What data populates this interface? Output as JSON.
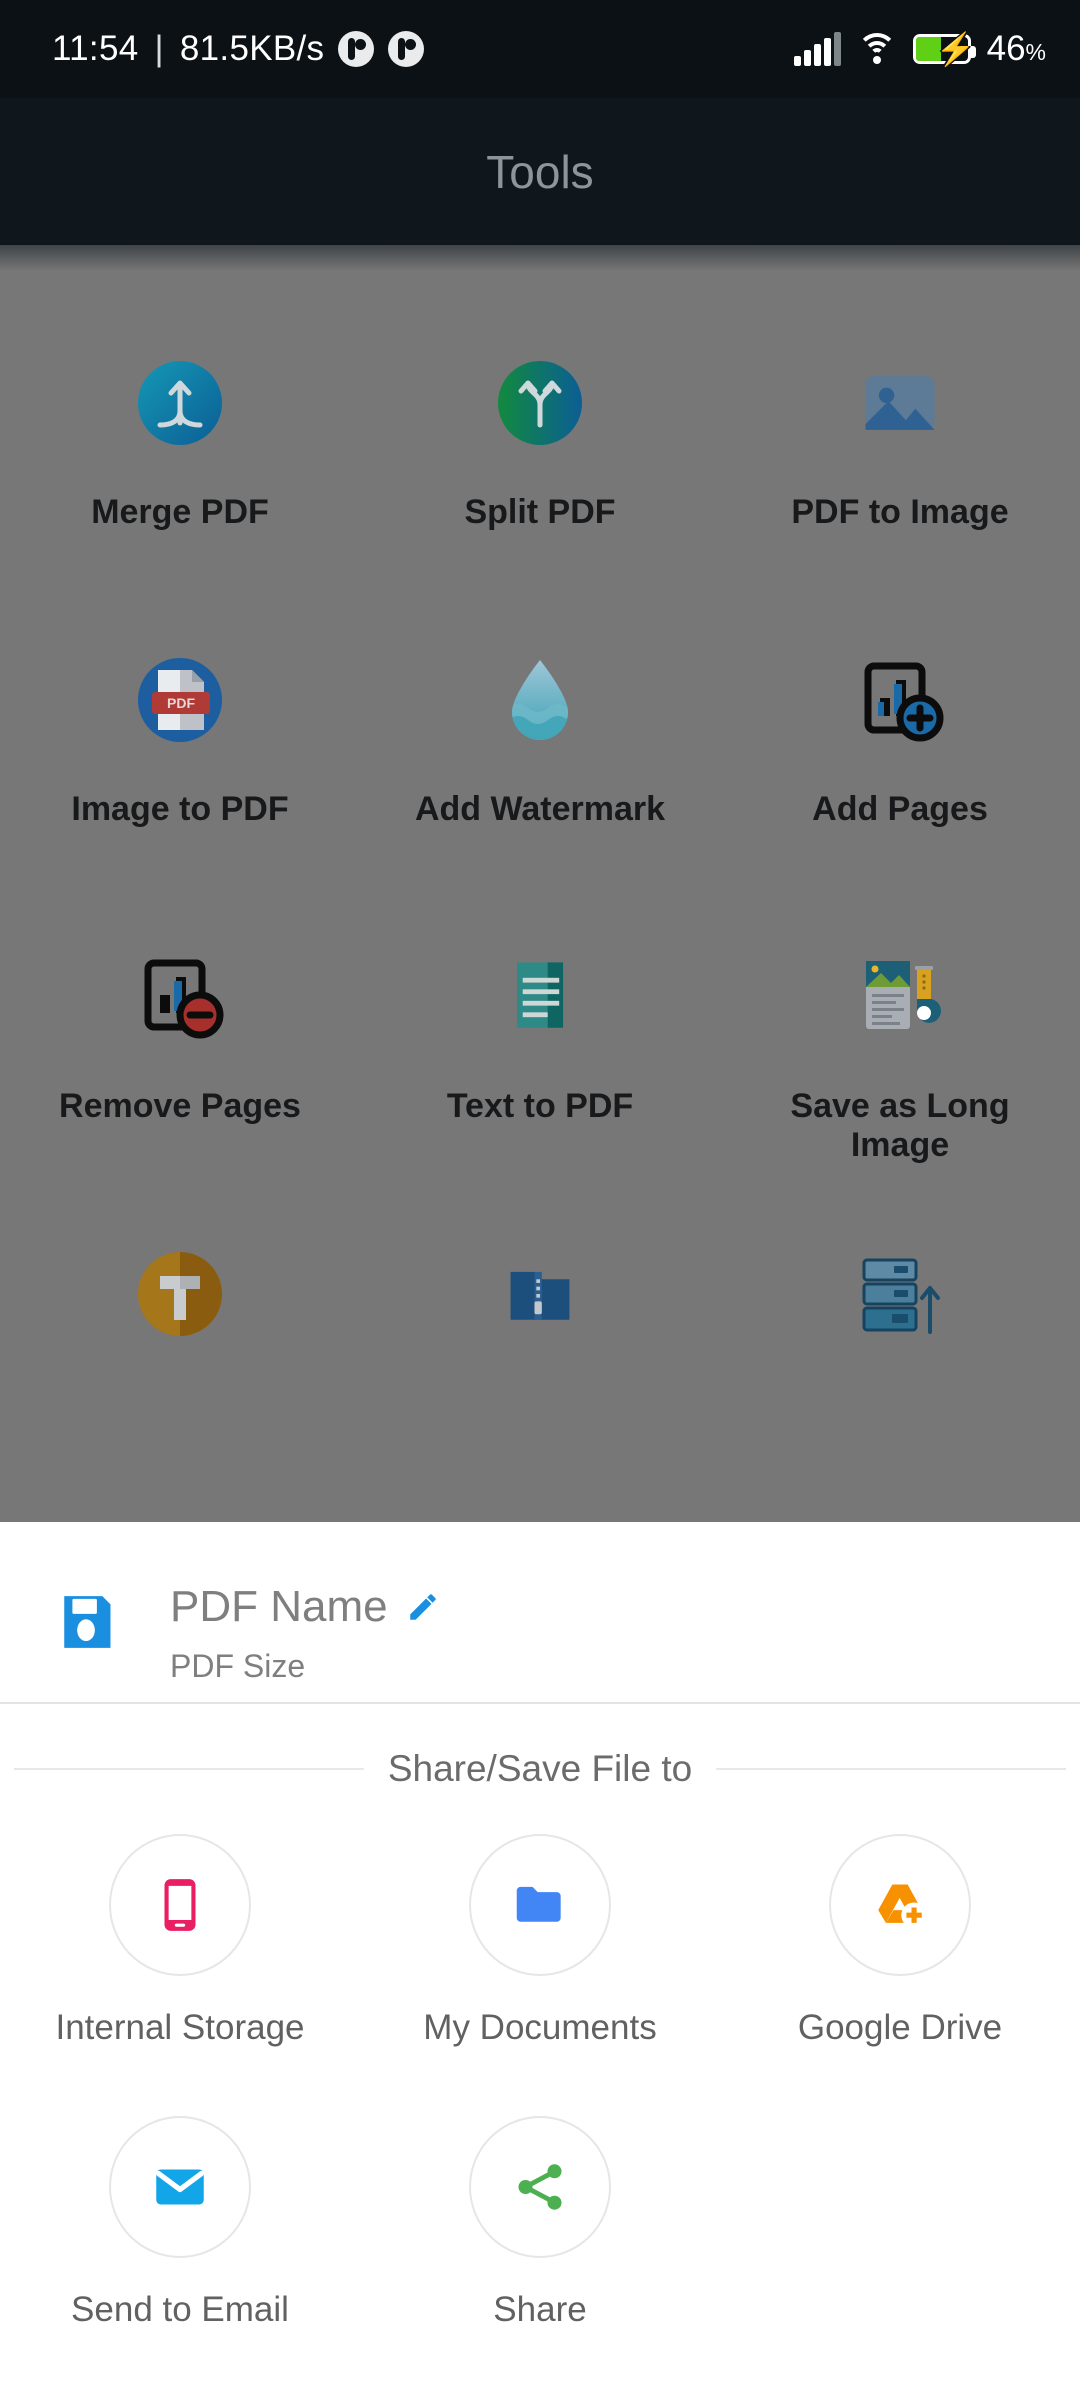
{
  "status_bar": {
    "time": "11:54",
    "separator": "|",
    "network_speed": "81.5KB/s",
    "notification_icons": [
      "app-notification-icon",
      "app-notification-icon"
    ],
    "signal_icon": "signal-bars-icon",
    "wifi_icon": "wifi-icon",
    "battery_icon": "battery-charging-icon",
    "battery_percent": "46",
    "battery_percent_symbol": "%"
  },
  "app_bar": {
    "title": "Tools"
  },
  "tools": {
    "items": [
      {
        "label": "Merge PDF",
        "icon": "merge-pdf-icon"
      },
      {
        "label": "Split PDF",
        "icon": "split-pdf-icon"
      },
      {
        "label": "PDF to Image",
        "icon": "pdf-to-image-icon"
      },
      {
        "label": "Image to PDF",
        "icon": "image-to-pdf-icon"
      },
      {
        "label": "Add Watermark",
        "icon": "add-watermark-icon"
      },
      {
        "label": "Add Pages",
        "icon": "add-pages-icon"
      },
      {
        "label": "Remove Pages",
        "icon": "remove-pages-icon"
      },
      {
        "label": "Text to PDF",
        "icon": "text-to-pdf-icon"
      },
      {
        "label": "Save as Long Image",
        "icon": "save-as-long-image-icon"
      },
      {
        "label": "",
        "icon": "text-tool-icon"
      },
      {
        "label": "",
        "icon": "zip-folder-icon"
      },
      {
        "label": "",
        "icon": "extract-files-icon"
      }
    ]
  },
  "sheet": {
    "save_icon": "floppy-save-icon",
    "pdf_name": "PDF Name",
    "edit_icon": "edit-pencil-icon",
    "pdf_size": "PDF Size",
    "share_section_title": "Share/Save File to",
    "share_targets": [
      {
        "label": "Internal Storage",
        "icon": "phone-icon",
        "color": "#e91e63"
      },
      {
        "label": "My Documents",
        "icon": "folder-icon",
        "color": "#4285f4"
      },
      {
        "label": "Google Drive",
        "icon": "google-drive-add-icon",
        "color": "#f79100"
      },
      {
        "label": "Send to Email",
        "icon": "email-envelope-icon",
        "color": "#12a5e8"
      },
      {
        "label": "Share",
        "icon": "share-nodes-icon",
        "color": "#4caf50"
      }
    ]
  },
  "colors": {
    "status_bar_bg": "#0b1115",
    "app_bar_bg": "#0f171d",
    "scrim": "#777777",
    "sheet_bg": "#ffffff",
    "battery_green": "#5fd016",
    "accent_blue": "#1a8fe0"
  }
}
